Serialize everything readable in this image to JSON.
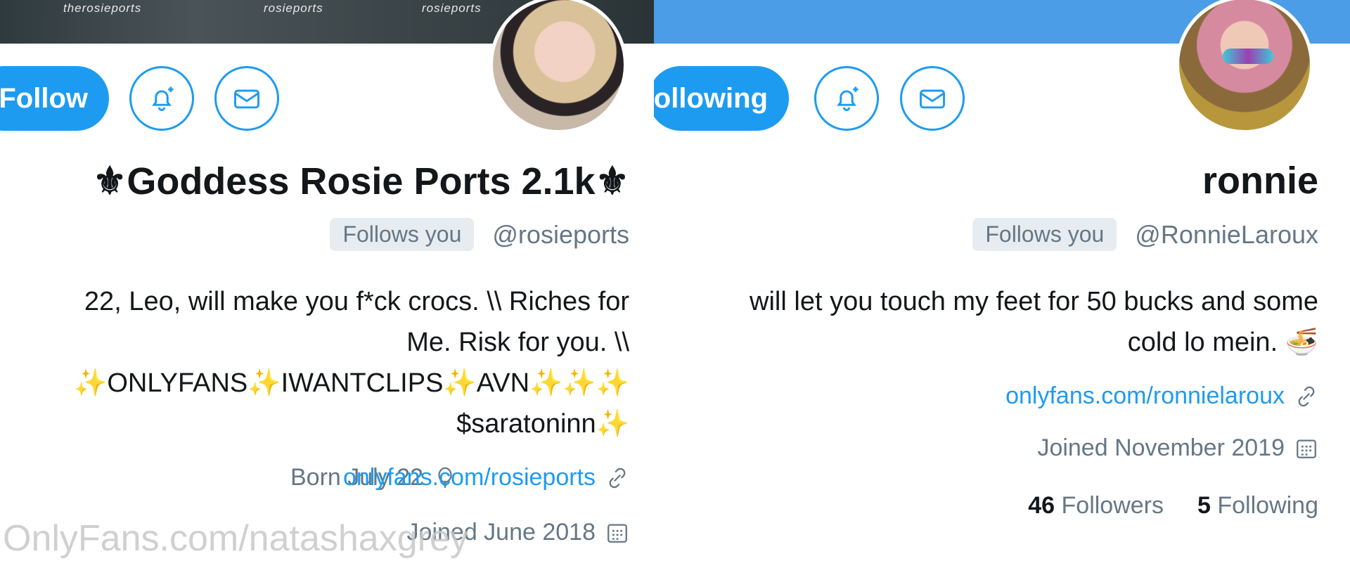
{
  "left_profile": {
    "banner_texts": [
      "therosieports",
      "rosieports",
      "rosieports"
    ],
    "follow_label": "Follow",
    "name": "⚜Goddess Rosie Ports 2.1k⚜",
    "handle": "@rosieports",
    "follows_you": "Follows you",
    "bio_lines": [
      "22, Leo, will make you f*ck crocs. \\\\ Riches for",
      "Me. Risk for you. \\\\",
      "✨ONLYFANS✨IWANTCLIPS✨AVN✨✨✨",
      "$saratoninn✨"
    ],
    "link": "onlyfans.com/rosieports",
    "born": "Born July 22",
    "joined": "Joined June 2018"
  },
  "right_profile": {
    "follow_label": "Following",
    "name": "ronnie",
    "handle": "@RonnieLaroux",
    "follows_you": "Follows you",
    "bio_lines": [
      "will let you touch my feet for 50 bucks and some",
      "cold lo mein. 🍜"
    ],
    "link": "onlyfans.com/ronnielaroux",
    "joined": "Joined November 2019",
    "following_count": "5",
    "following_label": "Following",
    "followers_count": "46",
    "followers_label": "Followers"
  },
  "watermark": "OnlyFans.com/natashaxgrey",
  "colors": {
    "accent": "#1d9bf0",
    "muted": "#657786",
    "banner_right": "#4a9de6"
  }
}
